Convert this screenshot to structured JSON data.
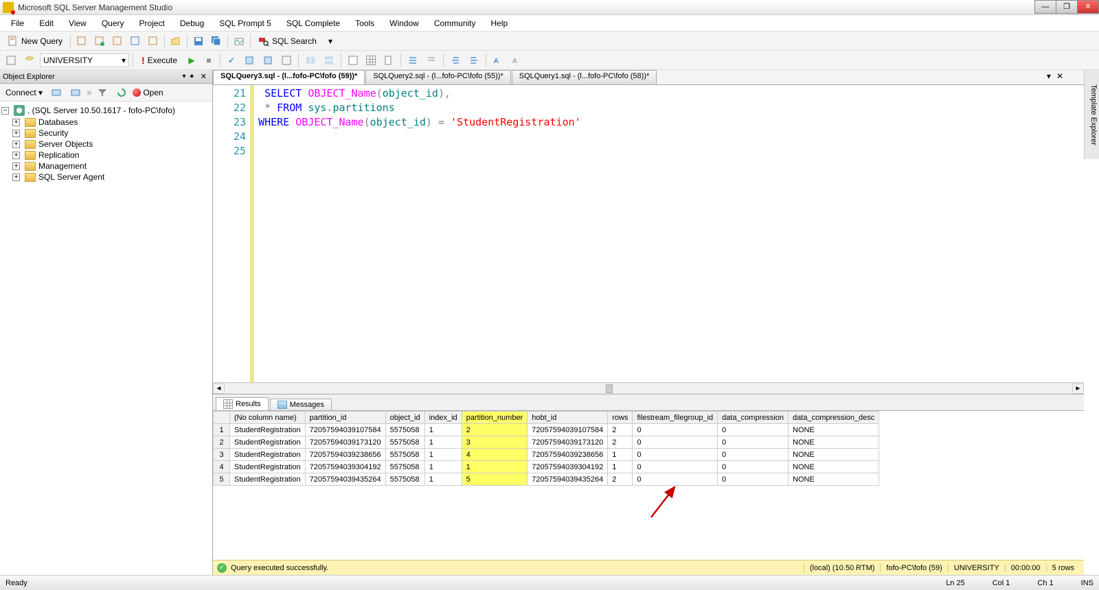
{
  "window": {
    "title": "Microsoft SQL Server Management Studio"
  },
  "menu": [
    "File",
    "Edit",
    "View",
    "Query",
    "Project",
    "Debug",
    "SQL Prompt 5",
    "SQL Complete",
    "Tools",
    "Window",
    "Community",
    "Help"
  ],
  "toolbar1": {
    "newquery": "New Query",
    "sqlsearch": "SQL Search"
  },
  "toolbar2": {
    "db": "UNIVERSITY",
    "execute": "Execute"
  },
  "objectExplorer": {
    "title": "Object Explorer",
    "connect": "Connect",
    "open": "Open",
    "server": ". (SQL Server 10.50.1617 - fofo-PC\\fofo)",
    "nodes": [
      "Databases",
      "Security",
      "Server Objects",
      "Replication",
      "Management",
      "SQL Server Agent"
    ]
  },
  "tabs": [
    "SQLQuery3.sql - (l...fofo-PC\\fofo (59))*",
    "SQLQuery2.sql - (l...fofo-PC\\fofo (55))*",
    "SQLQuery1.sql - (l...fofo-PC\\fofo (58))*"
  ],
  "templateExplorer": "Template Explorer",
  "code": {
    "lines": [
      "21",
      "22",
      "23",
      "24",
      "25"
    ]
  },
  "resultsTabs": {
    "results": "Results",
    "messages": "Messages"
  },
  "grid": {
    "headers": [
      "(No column name)",
      "partition_id",
      "object_id",
      "index_id",
      "partition_number",
      "hobt_id",
      "rows",
      "filestream_filegroup_id",
      "data_compression",
      "data_compression_desc"
    ],
    "rows": [
      [
        "1",
        "StudentRegistration",
        "72057594039107584",
        "5575058",
        "1",
        "2",
        "72057594039107584",
        "2",
        "0",
        "0",
        "NONE"
      ],
      [
        "2",
        "StudentRegistration",
        "72057594039173120",
        "5575058",
        "1",
        "3",
        "72057594039173120",
        "2",
        "0",
        "0",
        "NONE"
      ],
      [
        "3",
        "StudentRegistration",
        "72057594039238656",
        "5575058",
        "1",
        "4",
        "72057594039238656",
        "1",
        "0",
        "0",
        "NONE"
      ],
      [
        "4",
        "StudentRegistration",
        "72057594039304192",
        "5575058",
        "1",
        "1",
        "72057594039304192",
        "1",
        "0",
        "0",
        "NONE"
      ],
      [
        "5",
        "StudentRegistration",
        "72057594039435264",
        "5575058",
        "1",
        "5",
        "72057594039435264",
        "2",
        "0",
        "0",
        "NONE"
      ]
    ]
  },
  "queryStatus": {
    "msg": "Query executed successfully.",
    "server": "(local) (10.50 RTM)",
    "user": "fofo-PC\\fofo (59)",
    "db": "UNIVERSITY",
    "time": "00:00:00",
    "rows": "5 rows"
  },
  "statusbar": {
    "ready": "Ready",
    "ln": "Ln 25",
    "col": "Col 1",
    "ch": "Ch 1",
    "ins": "INS"
  }
}
